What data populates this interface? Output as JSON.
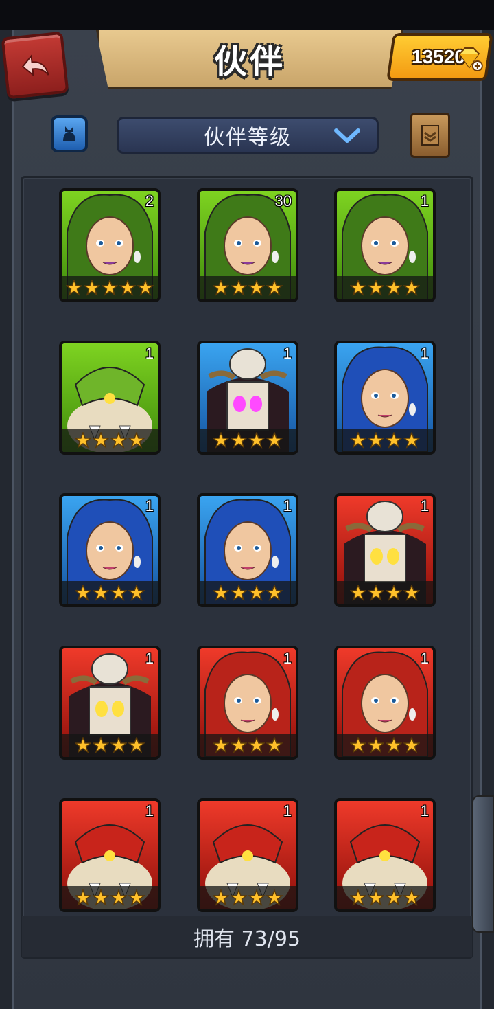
{
  "header": {
    "title": "伙伴",
    "gems": "13520"
  },
  "filter": {
    "sort_label": "伙伴等级"
  },
  "heroes": [
    {
      "level": "2",
      "stars": 5,
      "color": "green",
      "portrait": "green-haired-woman"
    },
    {
      "level": "30",
      "stars": 4,
      "color": "green",
      "portrait": "green-haired-warrior"
    },
    {
      "level": "1",
      "stars": 4,
      "color": "green",
      "portrait": "dark-haired-woman"
    },
    {
      "level": "1",
      "stars": 4,
      "color": "green",
      "portrait": "green-beast"
    },
    {
      "level": "1",
      "stars": 4,
      "color": "blue",
      "portrait": "skull-mask-shaman"
    },
    {
      "level": "1",
      "stars": 4,
      "color": "blue",
      "portrait": "blue-haired-woman"
    },
    {
      "level": "1",
      "stars": 4,
      "color": "blue",
      "portrait": "blue-haired-woman"
    },
    {
      "level": "1",
      "stars": 4,
      "color": "blue",
      "portrait": "blue-haired-woman"
    },
    {
      "level": "1",
      "stars": 4,
      "color": "red",
      "portrait": "skull-mask-shaman"
    },
    {
      "level": "1",
      "stars": 4,
      "color": "red",
      "portrait": "skull-mask-shaman"
    },
    {
      "level": "1",
      "stars": 4,
      "color": "red",
      "portrait": "red-haired-woman"
    },
    {
      "level": "1",
      "stars": 4,
      "color": "red",
      "portrait": "red-haired-woman"
    },
    {
      "level": "1",
      "stars": 4,
      "color": "red",
      "portrait": "red-beast"
    },
    {
      "level": "1",
      "stars": 4,
      "color": "red",
      "portrait": "red-beast"
    },
    {
      "level": "1",
      "stars": 4,
      "color": "red",
      "portrait": "red-beast"
    }
  ],
  "footer": {
    "owned": "拥有 73/95"
  },
  "colors": {
    "green": "#5fb81a",
    "blue": "#2a7fd4",
    "red": "#d2281c",
    "gold": "#ffc02a"
  }
}
